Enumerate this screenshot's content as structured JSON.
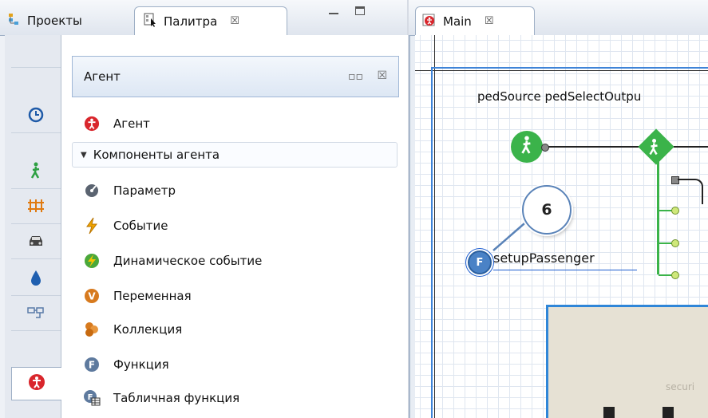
{
  "left_tabs": {
    "projects_label": "Проекты",
    "palette_label": "Палитра",
    "close_glyph": "☒"
  },
  "palette": {
    "section_title": "Агент",
    "section_controls": {
      "grid": "▫▫",
      "close": "☒"
    },
    "top_item": "Агент",
    "group_label": "Компоненты агента",
    "items": [
      {
        "label": "Параметр",
        "icon": "parameter-icon"
      },
      {
        "label": "Событие",
        "icon": "event-icon"
      },
      {
        "label": "Динамическое событие",
        "icon": "dynamic-event-icon"
      },
      {
        "label": "Переменная",
        "icon": "variable-icon"
      },
      {
        "label": "Коллекция",
        "icon": "collection-icon"
      },
      {
        "label": "Функция",
        "icon": "function-icon"
      },
      {
        "label": "Табличная функция",
        "icon": "table-function-icon"
      }
    ],
    "categories": [
      "clock-icon",
      "pedestrian-icon",
      "rail-icon",
      "car-icon",
      "fluid-icon",
      "process-icon",
      "agent-icon"
    ]
  },
  "editor": {
    "tab_label": "Main",
    "blocks_label": "pedSource pedSelectOutpu",
    "callout_number": "6",
    "function_letter": "F",
    "function_name": "setupPassenger",
    "area_label": "securi"
  },
  "colors": {
    "accent_blue": "#3f84d8",
    "ped_green": "#3bb34a",
    "agent_red": "#d9262c"
  }
}
